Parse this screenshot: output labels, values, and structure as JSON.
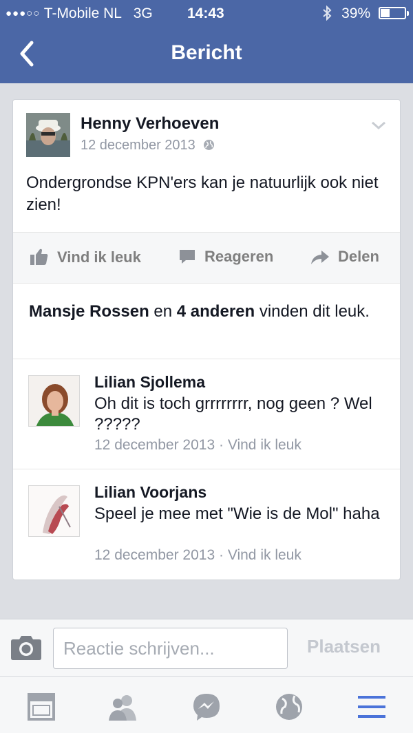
{
  "status_bar": {
    "signal": "●●●○○",
    "carrier": "T-Mobile NL",
    "network": "3G",
    "time": "14:43",
    "battery": "39%",
    "battery_level": 0.39
  },
  "nav": {
    "title": "Bericht"
  },
  "post": {
    "author": "Henny Verhoeven",
    "date": "12 december 2013",
    "text": "Ondergrondse KPN'ers kan je natuurlijk ook niet zien!"
  },
  "actions": {
    "like": "Vind ik leuk",
    "comment": "Reageren",
    "share": "Delen"
  },
  "likes": {
    "name": "Mansje Rossen",
    "connector": "en",
    "others": "4 anderen",
    "suffix": "vinden dit leuk."
  },
  "comments": [
    {
      "name": "Lilian Sjollema",
      "text": "Oh dit is toch grrrrrrrr, nog geen ? Wel ?????",
      "date": "12 december 2013",
      "separator": "·",
      "like": "Vind ik leuk"
    },
    {
      "name": "Lilian Voorjans",
      "text": "Speel je mee met \"Wie is de Mol\" haha",
      "date": "12 december 2013",
      "separator": "·",
      "like": "Vind ik leuk"
    }
  ],
  "composer": {
    "placeholder": "Reactie schrijven...",
    "post_label": "Plaatsen"
  },
  "tabs": [
    "news-feed-icon",
    "friends-icon",
    "messenger-icon",
    "globe-icon",
    "menu-icon"
  ],
  "colors": {
    "brand": "#4b67a6",
    "active_tab": "#4b73d9",
    "muted": "#9197a3"
  }
}
